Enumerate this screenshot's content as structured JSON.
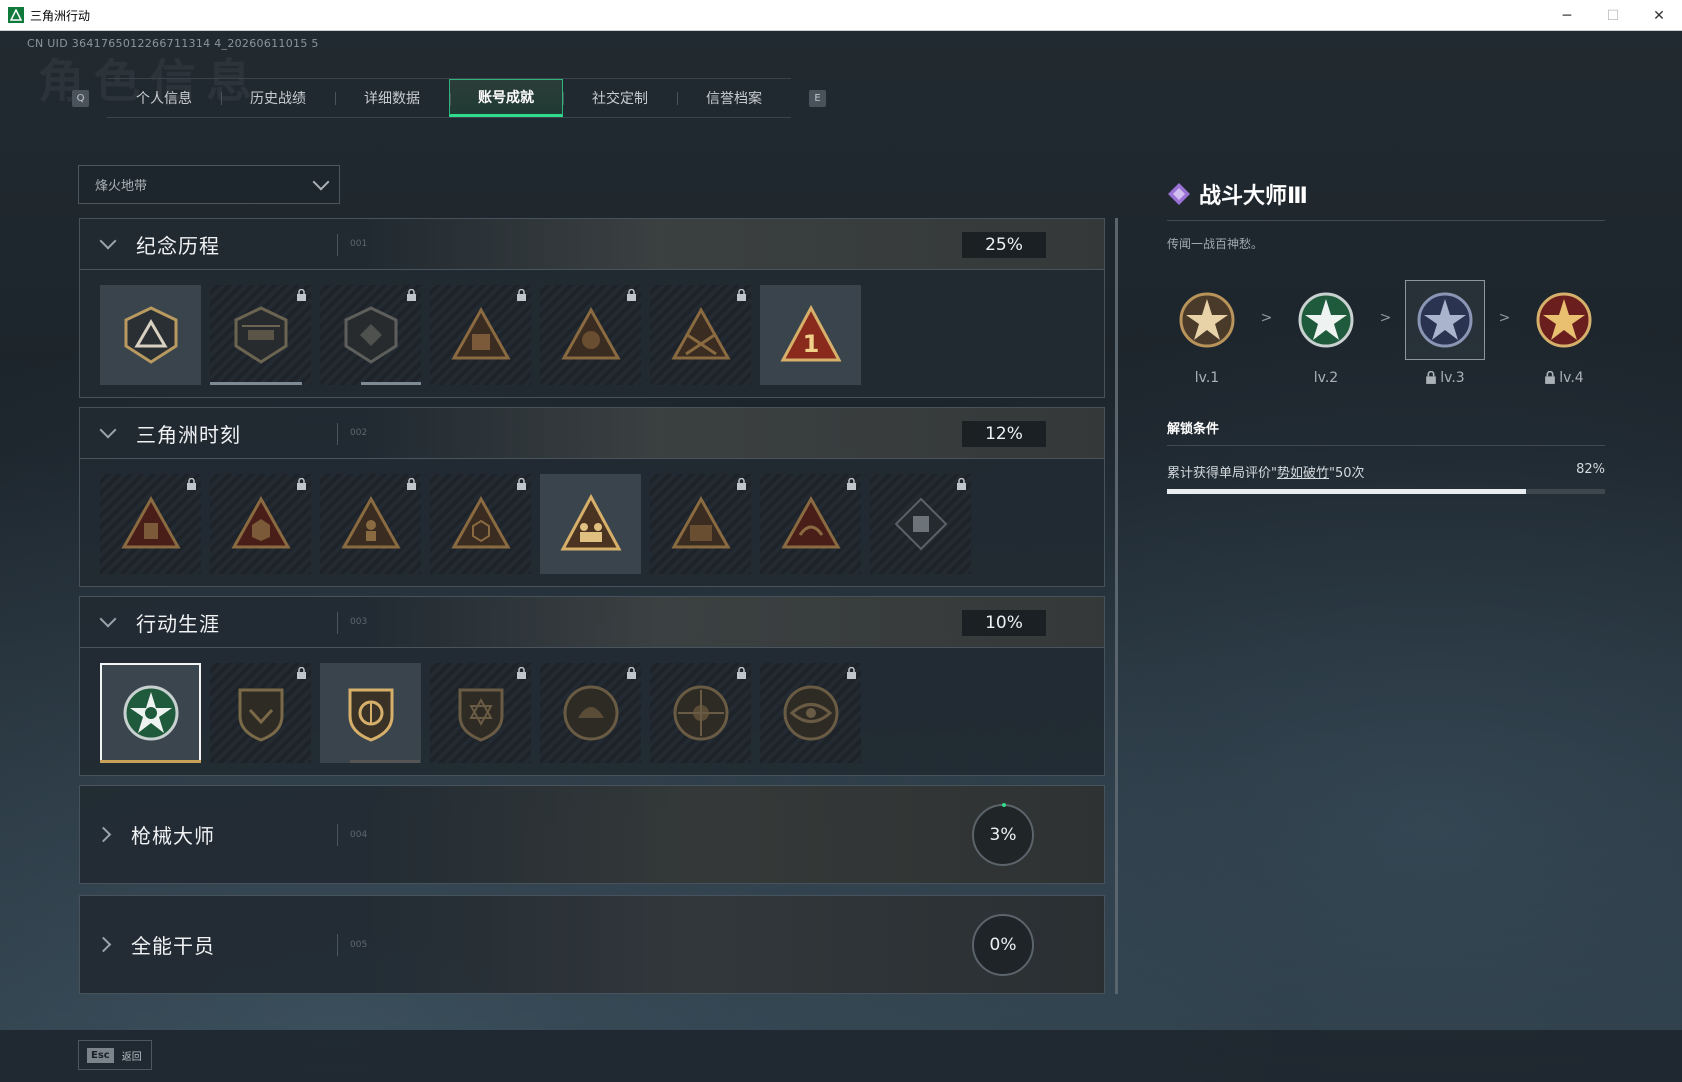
{
  "window": {
    "title": "三角洲行动",
    "min": "─",
    "max": "☐",
    "close": "✕"
  },
  "uid": "CN UID 3641765012266711314 4_20260611015 5",
  "bg_title": "角色信息",
  "tabs": {
    "left_key": "Q",
    "right_key": "E",
    "items": [
      {
        "label": "个人信息"
      },
      {
        "label": "历史战绩"
      },
      {
        "label": "详细数据"
      },
      {
        "label": "账号成就",
        "active": true
      },
      {
        "label": "社交定制"
      },
      {
        "label": "信誉档案"
      }
    ]
  },
  "dropdown": {
    "value": "烽火地带"
  },
  "categories": [
    {
      "title": "纪念历程",
      "index": "001",
      "percent": "25%",
      "expanded": true
    },
    {
      "title": "三角洲时刻",
      "index": "002",
      "percent": "12%",
      "expanded": true
    },
    {
      "title": "行动生涯",
      "index": "003",
      "percent": "10%",
      "expanded": true
    },
    {
      "title": "枪械大师",
      "index": "004",
      "percent": "3%",
      "expanded": false
    },
    {
      "title": "全能干员",
      "index": "005",
      "percent": "0%",
      "expanded": false
    }
  ],
  "detail": {
    "title": "战斗大师Ⅲ",
    "description": "传闻一战百神愁。",
    "levels": [
      {
        "label": "lv.1",
        "locked": false
      },
      {
        "label": "lv.2",
        "locked": false
      },
      {
        "label": "lv.3",
        "locked": true,
        "current": true
      },
      {
        "label": "lv.4",
        "locked": true
      }
    ],
    "level_arrow": ">",
    "condition_title": "解锁条件",
    "condition_prefix": "累计获得单局评价\"",
    "condition_highlight": "势如破竹",
    "condition_suffix": "\"50次",
    "condition_percent": "82%",
    "condition_progress": 0.82
  },
  "bottom": {
    "esc_key": "Esc",
    "esc_label": "返回"
  },
  "colors": {
    "accent": "#2fdc8c",
    "gold": "#c9a25a",
    "purple": "#b08ce0"
  }
}
